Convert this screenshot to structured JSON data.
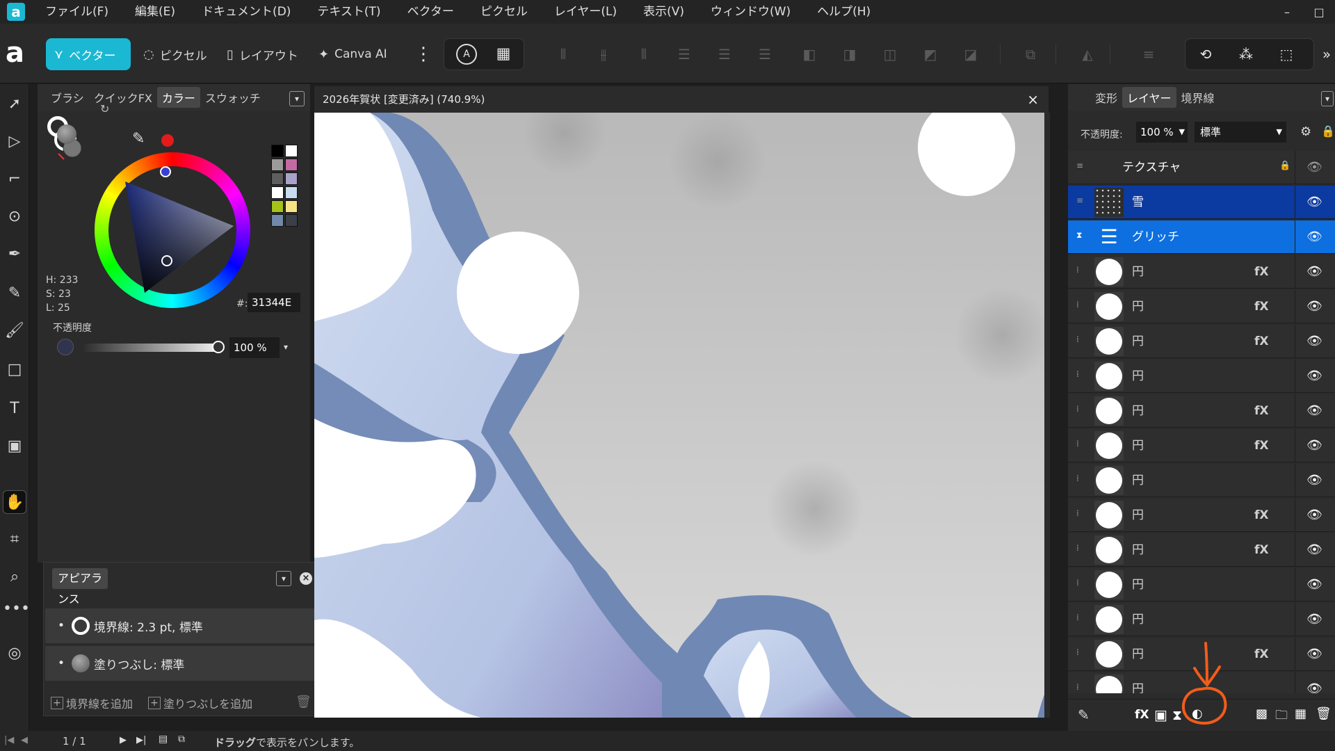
{
  "menubar": {
    "items": [
      "ファイル(F)",
      "編集(E)",
      "ドキュメント(D)",
      "テキスト(T)",
      "ベクター",
      "ピクセル",
      "レイヤー(L)",
      "表示(V)",
      "ウィンドウ(W)",
      "ヘルプ(H)"
    ],
    "controls": [
      "–",
      "□"
    ]
  },
  "toolbar": {
    "logo": "a",
    "personas": [
      "ベクター",
      "ピクセル",
      "レイアウト",
      "Canva AI"
    ],
    "more": "⋮"
  },
  "color_panel": {
    "tabs": [
      "ブラシ",
      "クイックFX",
      "カラー",
      "スウォッチ"
    ],
    "hsl": {
      "h": "H: 233",
      "s": "S: 23",
      "l": "L: 25"
    },
    "hex_label": "#:",
    "hex_value": "31344E",
    "opacity_label": "不透明度",
    "opacity_value": "100 %",
    "swatch_colors": [
      "#000000",
      "#ffffff",
      "#9b9b9b",
      "#c46aa3",
      "#5e5e5e",
      "#a8a3c8",
      "#ffffff",
      "#c9dcf0",
      "#a4c21a",
      "#f5e386",
      "#7088aa",
      "#3b4048"
    ]
  },
  "appearance": {
    "title": "アピアランス",
    "stroke": "境界線: 2.3 pt,  標準",
    "fill": "塗りつぶし:  標準",
    "add_stroke": "境界線を追加",
    "add_fill": "塗りつぶしを追加"
  },
  "document": {
    "title": "2026年賀状 [変更済み] (740.9%)",
    "close": "×"
  },
  "layers_panel": {
    "tabs": [
      "変形",
      "レイヤー",
      "境界線"
    ],
    "opacity_label": "不透明度:",
    "opacity_value": "100 %",
    "blend_mode": "標準",
    "layers": [
      {
        "name": "テクスチャ",
        "type": "group",
        "fx": false
      },
      {
        "name": "雪",
        "type": "selected-dark",
        "fx": false
      },
      {
        "name": "グリッチ",
        "type": "selected",
        "fx": false
      },
      {
        "name": "円",
        "type": "circle",
        "fx": true
      },
      {
        "name": "円",
        "type": "circle",
        "fx": true
      },
      {
        "name": "円",
        "type": "circle",
        "fx": true
      },
      {
        "name": "円",
        "type": "circle",
        "fx": false
      },
      {
        "name": "円",
        "type": "circle",
        "fx": true
      },
      {
        "name": "円",
        "type": "circle",
        "fx": true
      },
      {
        "name": "円",
        "type": "circle",
        "fx": false
      },
      {
        "name": "円",
        "type": "circle",
        "fx": true
      },
      {
        "name": "円",
        "type": "circle",
        "fx": true
      },
      {
        "name": "円",
        "type": "circle",
        "fx": false
      },
      {
        "name": "円",
        "type": "circle",
        "fx": false
      },
      {
        "name": "円",
        "type": "circle",
        "fx": true
      },
      {
        "name": "円",
        "type": "circle",
        "fx": false
      }
    ],
    "fx_label": "fX"
  },
  "statusbar": {
    "page": "1 / 1",
    "hint_bold": "ドラッグ",
    "hint_rest": "で表示をパンします。"
  },
  "colors": {
    "accent": "#1ab8d3",
    "selected_layer": "#0d6fe0",
    "selected_layer_dark": "#0b3aa0",
    "annotation": "#f25c1a",
    "mountain_stroke": "#7088b4",
    "mountain_fill": "#c3d1ea"
  }
}
